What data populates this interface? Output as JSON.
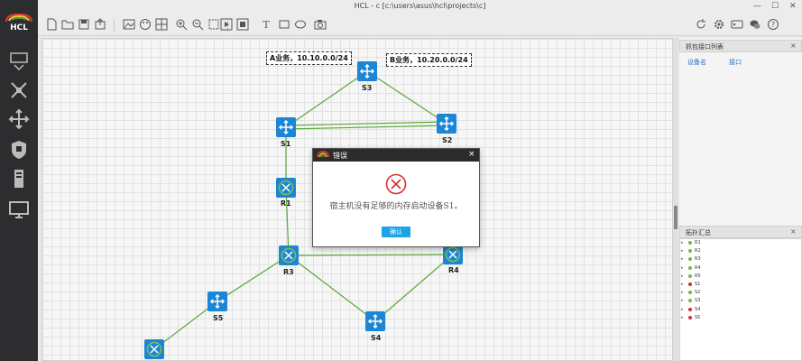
{
  "window": {
    "title": "HCL - c [c:\\users\\asus\\hcl\\projects\\c]",
    "logo_text": "HCL"
  },
  "canvas": {
    "biz_a": "A业务，10.10.0.0/24",
    "biz_b": "B业务，10.20.0.0/24",
    "devices": [
      "S3",
      "S1",
      "S2",
      "R1",
      "R3",
      "R4",
      "S5",
      "S4"
    ]
  },
  "dialog": {
    "title": "错误",
    "message": "宿主机没有足够的内存启动设备S1。",
    "ok_label": "确认",
    "close_glyph": "×"
  },
  "capture_panel": {
    "title": "抓包接口列表",
    "col_device": "设备名",
    "col_interface": "接口"
  },
  "topology_panel": {
    "title": "拓扑汇总",
    "items": [
      {
        "name": "R1",
        "status_color": "#7cb342"
      },
      {
        "name": "R2",
        "status_color": "#7cb342"
      },
      {
        "name": "R3",
        "status_color": "#7cb342"
      },
      {
        "name": "R4",
        "status_color": "#7cb342"
      },
      {
        "name": "R5",
        "status_color": "#7cb342"
      },
      {
        "name": "S1",
        "status_color": "#d32f2f"
      },
      {
        "name": "S2",
        "status_color": "#7cb342"
      },
      {
        "name": "S3",
        "status_color": "#7cb342"
      },
      {
        "name": "S4",
        "status_color": "#d32f2f"
      },
      {
        "name": "S5",
        "status_color": "#d32f2f"
      }
    ]
  },
  "colors": {
    "device_blue": "#1b86d6",
    "link_green": "#5aa83a",
    "ok_blue": "#1ea3e6"
  }
}
